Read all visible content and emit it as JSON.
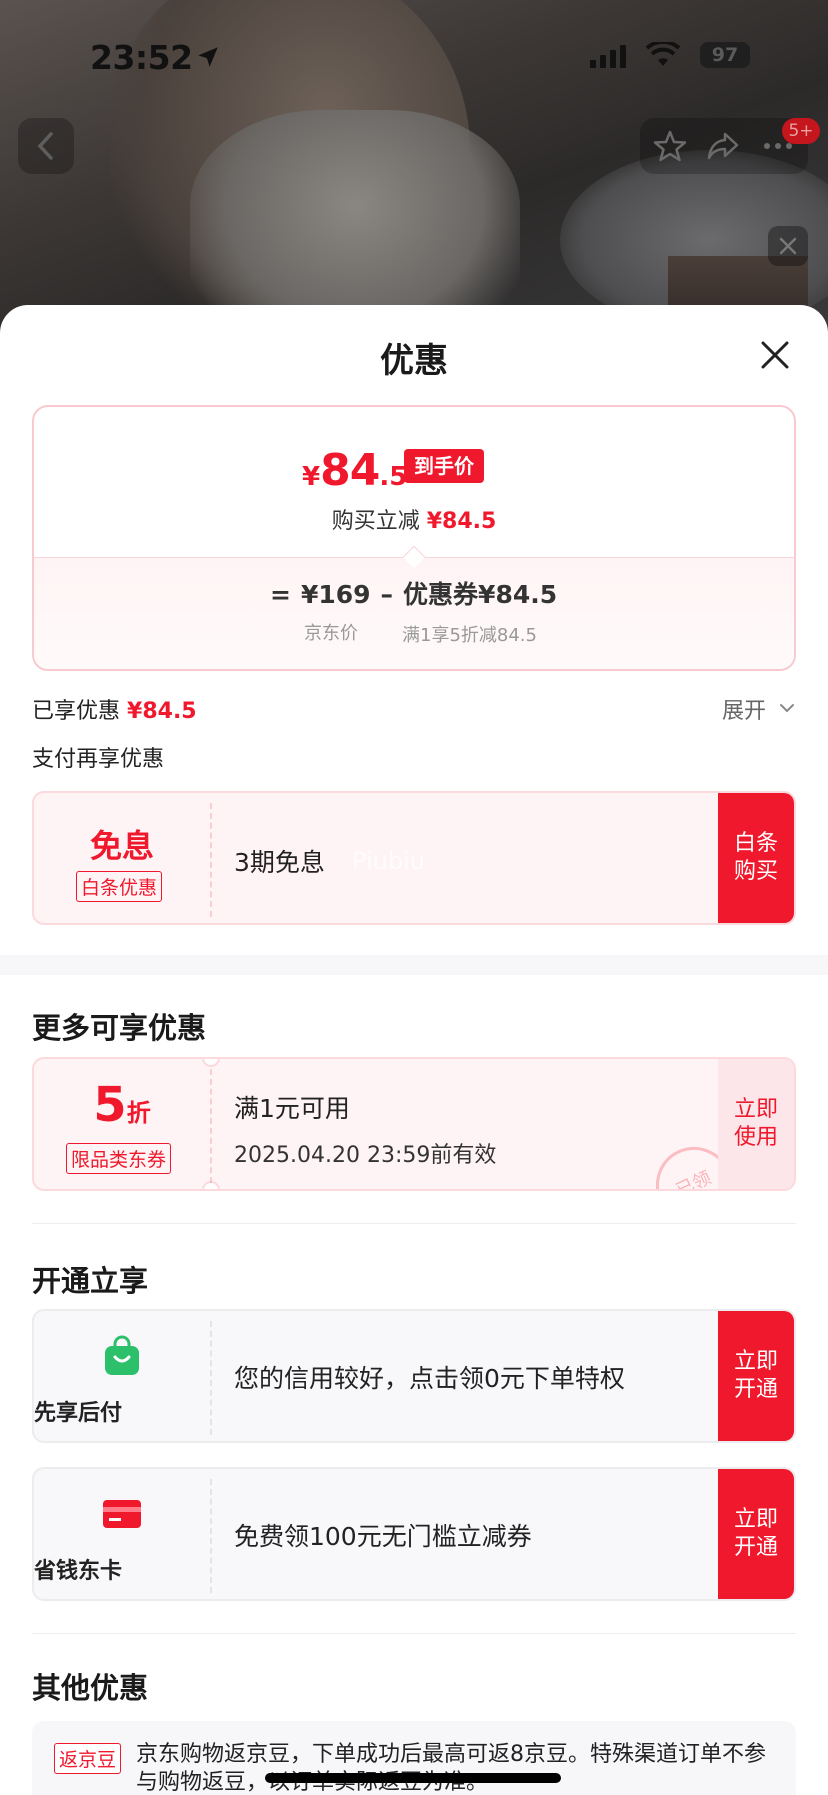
{
  "status_bar": {
    "time": "23:52",
    "battery": "97"
  },
  "nav": {
    "more_badge": "5+"
  },
  "sheet": {
    "title": "优惠",
    "price_card": {
      "currency": "¥",
      "price_int": "84",
      "price_dec": ".5",
      "arrive_tag": "到手价",
      "reduce_label": "购买立减",
      "reduce_value": "¥84.5",
      "formula_eq": "=",
      "formula_base": "¥169",
      "formula_minus": "–",
      "formula_coupon": "优惠券¥84.5",
      "base_caption": "京东价",
      "coupon_caption": "满1享5折减84.5"
    },
    "enjoyed_label": "已享优惠",
    "enjoyed_value": "¥84.5",
    "expand_label": "展开",
    "pay_title": "支付再享优惠",
    "baitiao": {
      "main": "免息",
      "tag": "白条优惠",
      "desc": "3期免息",
      "watermark": "Piubiu",
      "button": "白条购买"
    },
    "more_title": "更多可享优惠",
    "discount_coupon": {
      "number": "5",
      "unit": "折",
      "tag": "限品类东券",
      "desc": "满1元可用",
      "validity": "2025.04.20 23:59前有效",
      "stamp": "已领",
      "button": "立即使用"
    },
    "open_title": "开通立享",
    "credit": {
      "label": "先享后付",
      "desc": "您的信用较好，点击领0元下单特权",
      "button": "立即开通"
    },
    "card": {
      "label": "省钱东卡",
      "desc": "免费领100元无门槛立减券",
      "button": "立即开通"
    },
    "other_title": "其他优惠",
    "jingdou": {
      "tag": "返京豆",
      "text": "京东购物返京豆，下单成功后最高可返8京豆。特殊渠道订单不参与购物返豆，以订单实际返豆为准。"
    }
  },
  "colors": {
    "accent": "#f0182c",
    "coupon_bg": "#fff4f5",
    "green": "#2cc06b"
  },
  "icons": [
    "location-arrow-icon",
    "signal-icon",
    "wifi-icon",
    "back-icon",
    "star-icon",
    "share-icon",
    "more-icon",
    "close-icon",
    "chevron-down-icon",
    "shopping-bag-icon",
    "card-icon"
  ]
}
